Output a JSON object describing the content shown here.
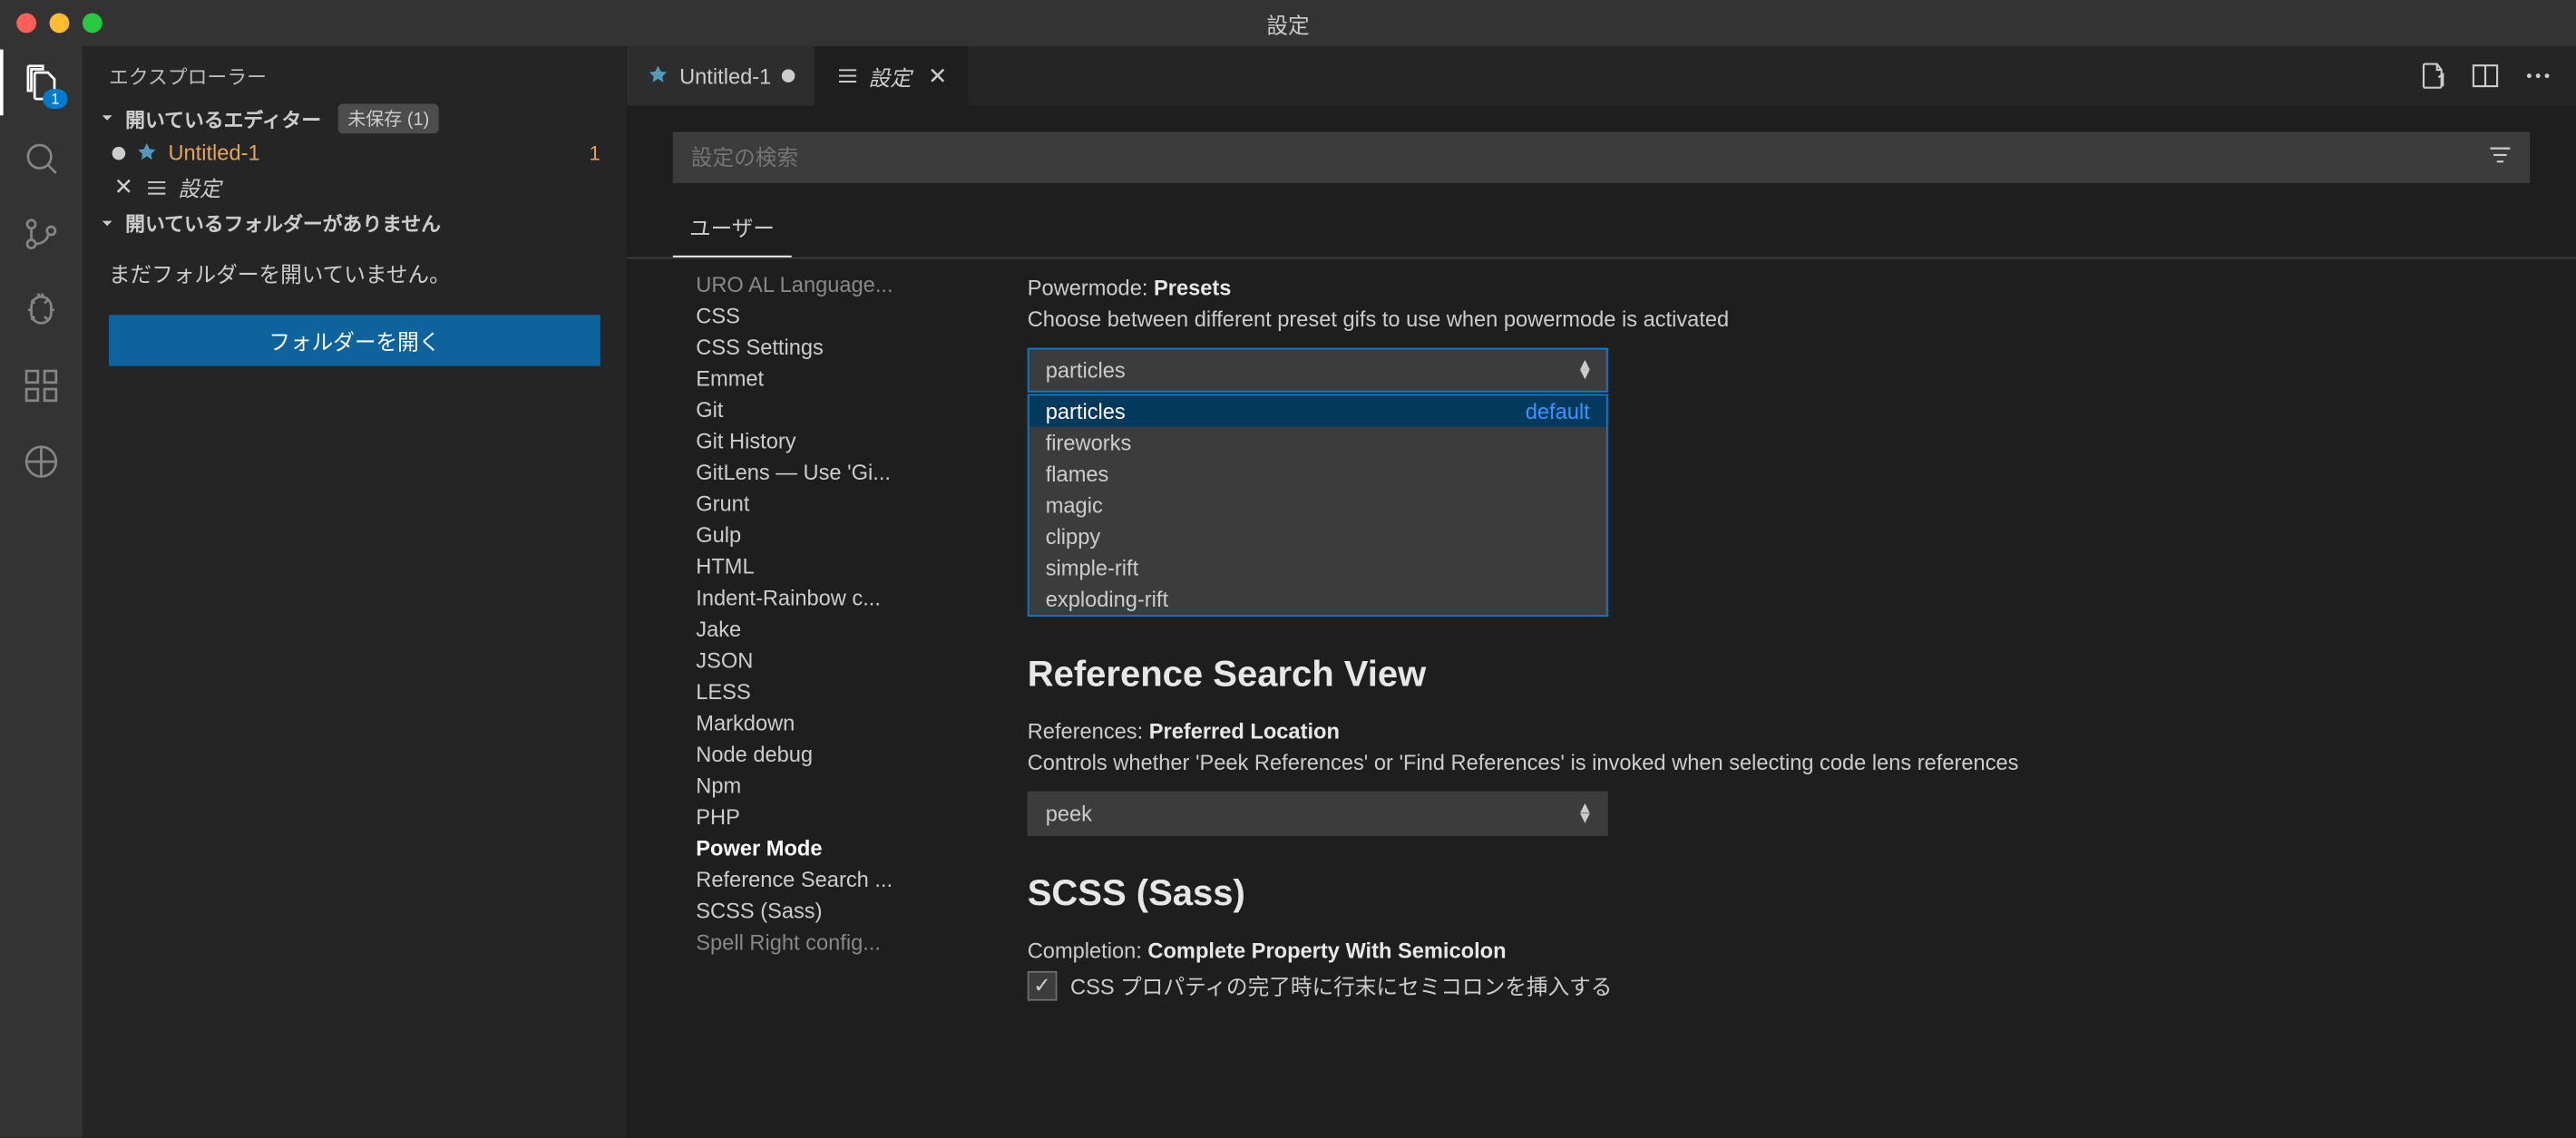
{
  "window": {
    "title": "設定"
  },
  "activity_badge": "1",
  "explorer": {
    "title": "エクスプローラー",
    "open_editors_header": "開いているエディター",
    "unsaved_tag": "未保存 (1)",
    "editor1": {
      "name": "Untitled-1",
      "count": "1"
    },
    "editor2": {
      "name": "設定"
    },
    "no_folder_header": "開いているフォルダーがありません",
    "no_folder_msg": "まだフォルダーを開いていません。",
    "open_folder_btn": "フォルダーを開く"
  },
  "tabs": {
    "tab1": "Untitled-1",
    "tab2": "設定"
  },
  "search": {
    "placeholder": "設定の検索"
  },
  "settings_tab": "ユーザー",
  "toc": {
    "i0": "URO AL Language...",
    "i1": "CSS",
    "i2": "CSS Settings",
    "i3": "Emmet",
    "i4": "Git",
    "i5": "Git History",
    "i6": "GitLens — Use 'Gi...",
    "i7": "Grunt",
    "i8": "Gulp",
    "i9": "HTML",
    "i10": "Indent-Rainbow c...",
    "i11": "Jake",
    "i12": "JSON",
    "i13": "LESS",
    "i14": "Markdown",
    "i15": "Node debug",
    "i16": "Npm",
    "i17": "PHP",
    "i18": "Power Mode",
    "i19": "Reference Search ...",
    "i20": "SCSS (Sass)",
    "i21": "Spell Right config..."
  },
  "settings": {
    "powermode": {
      "prefix": "Powermode: ",
      "name": "Presets",
      "desc": "Choose between different preset gifs to use when powermode is activated",
      "value": "particles",
      "options": {
        "o0": "particles",
        "o0d": "default",
        "o1": "fireworks",
        "o2": "flames",
        "o3": "magic",
        "o4": "clippy",
        "o5": "simple-rift",
        "o6": "exploding-rift"
      }
    },
    "ref_heading": "Reference Search View",
    "references": {
      "prefix": "References: ",
      "name": "Preferred Location",
      "desc": "Controls whether 'Peek References' or 'Find References' is invoked when selecting code lens references",
      "value": "peek"
    },
    "scss_heading": "SCSS (Sass)",
    "completion": {
      "prefix": "Completion: ",
      "name": "Complete Property With Semicolon",
      "desc": "CSS プロパティの完了時に行末にセミコロンを挿入する"
    }
  }
}
